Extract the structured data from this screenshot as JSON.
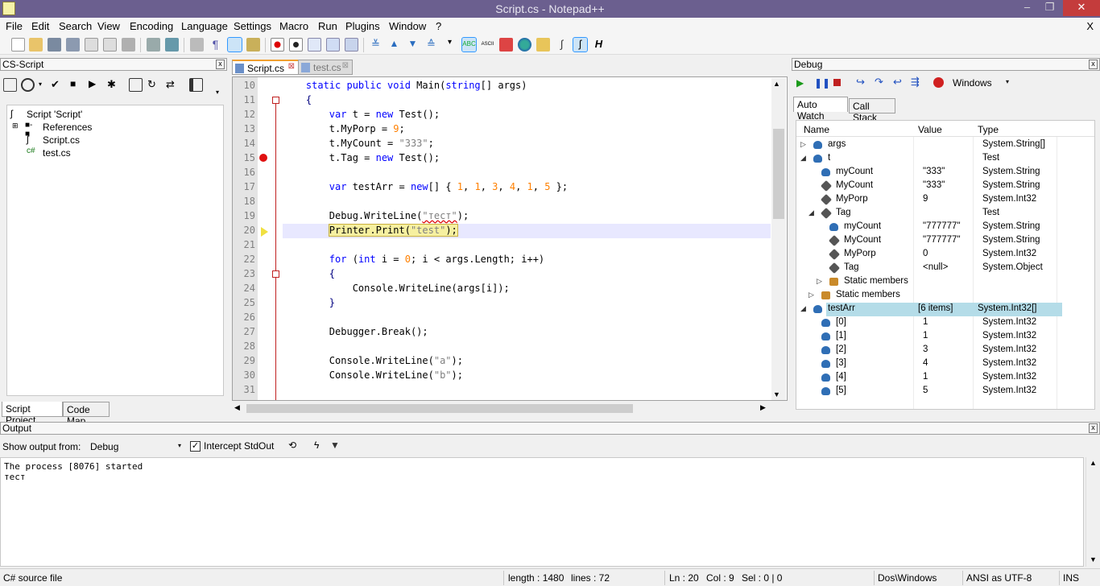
{
  "window": {
    "title": "Script.cs - Notepad++"
  },
  "menu": [
    "File",
    "Edit",
    "Search",
    "View",
    "Encoding",
    "Language",
    "Settings",
    "Macro",
    "Run",
    "Plugins",
    "Window",
    "?"
  ],
  "menu_close": "X",
  "left_panel": {
    "title": "CS-Script",
    "tree": [
      {
        "label": "Script 'Script'"
      },
      {
        "label": "References"
      },
      {
        "label": "Script.cs"
      },
      {
        "label": "test.cs"
      }
    ],
    "tabs": [
      "Script Project",
      "Code Map"
    ]
  },
  "editor": {
    "tabs": [
      "Script.cs",
      "test.cs"
    ],
    "line_numbers": [
      "10",
      "11",
      "12",
      "13",
      "14",
      "15",
      "16",
      "17",
      "18",
      "19",
      "20",
      "21",
      "22",
      "23",
      "24",
      "25",
      "26",
      "27",
      "28",
      "29",
      "30",
      "31"
    ]
  },
  "debug_panel": {
    "title": "Debug",
    "dropdown": "Windows",
    "tabs": [
      "Auto Watch",
      "Call Stack"
    ],
    "columns": [
      "Name",
      "Value",
      "Type"
    ],
    "rows": [
      {
        "name": "args",
        "value": "",
        "type": "System.String[]"
      },
      {
        "name": "t",
        "value": "",
        "type": "Test"
      },
      {
        "name": "myCount",
        "value": "\"333\"",
        "type": "System.String"
      },
      {
        "name": "MyCount",
        "value": "\"333\"",
        "type": "System.String"
      },
      {
        "name": "MyPorp",
        "value": "9",
        "type": "System.Int32"
      },
      {
        "name": "Tag",
        "value": "",
        "type": "Test"
      },
      {
        "name": "myCount",
        "value": "\"777777\"",
        "type": "System.String"
      },
      {
        "name": "MyCount",
        "value": "\"777777\"",
        "type": "System.String"
      },
      {
        "name": "MyPorp",
        "value": "0",
        "type": "System.Int32"
      },
      {
        "name": "Tag",
        "value": "<null>",
        "type": "System.Object"
      },
      {
        "name": "Static members",
        "value": "",
        "type": ""
      },
      {
        "name": "Static members",
        "value": "",
        "type": ""
      },
      {
        "name": "testArr",
        "value": "[6 items]",
        "type": "System.Int32[]"
      },
      {
        "name": "[0]",
        "value": "1",
        "type": "System.Int32"
      },
      {
        "name": "[1]",
        "value": "1",
        "type": "System.Int32"
      },
      {
        "name": "[2]",
        "value": "3",
        "type": "System.Int32"
      },
      {
        "name": "[3]",
        "value": "4",
        "type": "System.Int32"
      },
      {
        "name": "[4]",
        "value": "1",
        "type": "System.Int32"
      },
      {
        "name": "[5]",
        "value": "5",
        "type": "System.Int32"
      }
    ]
  },
  "output_panel": {
    "title": "Output",
    "show_from_label": "Show output from:",
    "source": "Debug",
    "intercept_label": "Intercept StdOut",
    "lines": [
      "The process [8076] started",
      "тест"
    ]
  },
  "status": {
    "file_type": "C# source file",
    "length": "length : 1480",
    "lines": "lines : 72",
    "ln": "Ln : 20",
    "col": "Col : 9",
    "sel": "Sel : 0 | 0",
    "eol": "Dos\\Windows",
    "encoding": "ANSI as UTF-8",
    "mode": "INS"
  },
  "colors": {
    "titlebar": "#6b5f8f",
    "breakpoint": "#e01010",
    "current_line": "#e8e8ff",
    "keyword": "#0000ff",
    "string": "#808080",
    "number": "#ff8000"
  }
}
